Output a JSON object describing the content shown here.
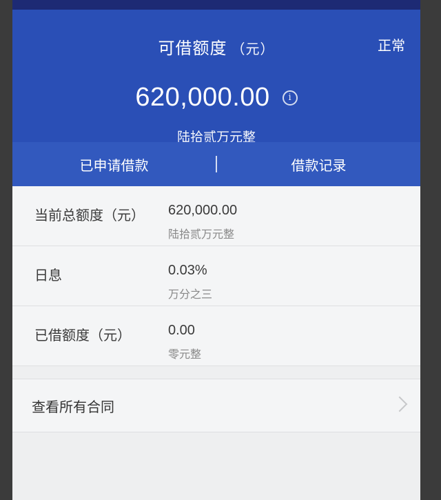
{
  "header": {
    "title": "可借额度",
    "title_unit": "（元）",
    "status": "正常",
    "amount": "620,000.00",
    "amount_words": "陆拾贰万元整",
    "info_icon": "info-icon"
  },
  "tabs": [
    {
      "label": "已申请借款"
    },
    {
      "label": "借款记录"
    }
  ],
  "details": [
    {
      "label": "当前总额度（元）",
      "value": "620,000.00",
      "sub": "陆拾贰万元整"
    },
    {
      "label": "日息",
      "value": "0.03%",
      "sub": "万分之三"
    },
    {
      "label": "已借额度（元）",
      "value": "0.00",
      "sub": "零元整"
    }
  ],
  "contracts": {
    "label": "查看所有合同",
    "icon": "chevron-right-icon"
  },
  "colors": {
    "header_bg": "#2a4fb6",
    "tabs_bg": "#3259be",
    "page_bg": "#f2f3f4"
  }
}
